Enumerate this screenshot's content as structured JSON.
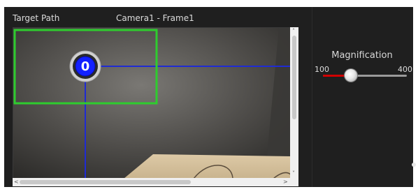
{
  "header": {
    "title": "Target Path",
    "camera_label": "Camera1 - Frame1"
  },
  "viewer": {
    "marker_label": "0",
    "colors": {
      "selection_box": "#2ecc2e",
      "path_lines": "#1f2bd3",
      "marker_fill": "#1220ff",
      "marker_ring": "#cfcfcf",
      "object_fill": "#d8c6a2"
    }
  },
  "magnification": {
    "title": "Magnification",
    "min_label": "100",
    "max_label": "400",
    "min": 100,
    "max": 400,
    "value": 200,
    "colors": {
      "fill": "#d10000",
      "track": "#9a9a9a"
    }
  },
  "scrollbars": {
    "up_arrow": "˄",
    "down_arrow": "˅",
    "left_arrow": "<",
    "right_arrow": ">"
  }
}
